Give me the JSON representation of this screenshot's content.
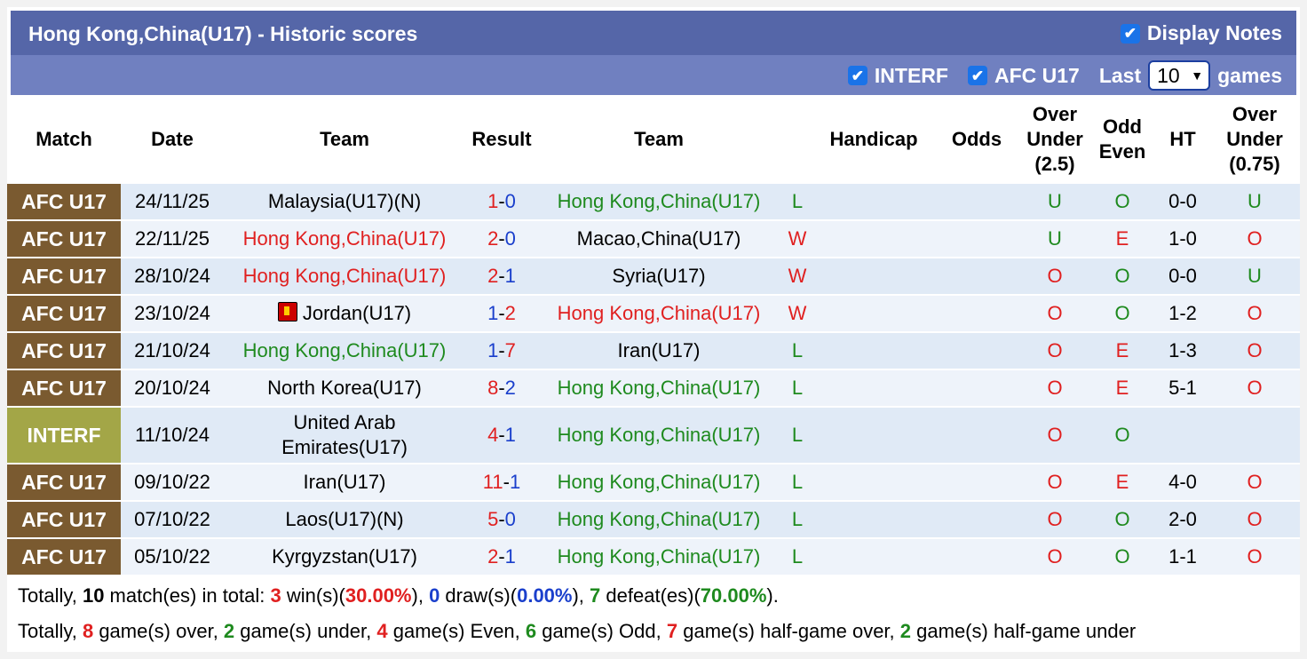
{
  "header": {
    "title": "Hong Kong,China(U17) - Historic scores",
    "display_notes_label": "Display Notes",
    "display_notes_checked": true
  },
  "filters": {
    "interf_label": "INTERF",
    "afc_label": "AFC U17",
    "last_label": "Last",
    "last_value": "10",
    "games_label": "games"
  },
  "columns": {
    "match": "Match",
    "date": "Date",
    "team_home": "Team",
    "result": "Result",
    "team_away": "Team",
    "handicap": "Handicap",
    "odds": "Odds",
    "ou_line1": "Over",
    "ou_line2": "Under",
    "ou_line3": "(2.5)",
    "oe_line1": "Odd",
    "oe_line2": "Even",
    "ht": "HT",
    "ouh_line1": "Over",
    "ouh_line2": "Under",
    "ouh_line3": "(0.75)"
  },
  "colors": {
    "afc": "#7a5a30",
    "interf": "#a3a647",
    "red": "#e02020",
    "green": "#1e8a1e",
    "blue": "#1a3fcc"
  },
  "rows": [
    {
      "league": "AFC U17",
      "league_type": "afc",
      "date": "24/11/25",
      "home": "Malaysia(U17)(N)",
      "home_color": "black",
      "home_flag": false,
      "score_home": "1",
      "score_home_color": "red",
      "score_away": "0",
      "score_away_color": "blue",
      "away": "Hong Kong,China(U17)",
      "away_color": "green",
      "wl": "L",
      "wl_color": "green",
      "handicap": "",
      "odds": "",
      "ou": "U",
      "ou_color": "green",
      "oe": "O",
      "oe_color": "green",
      "ht": "0-0",
      "ouh": "U",
      "ouh_color": "green"
    },
    {
      "league": "AFC U17",
      "league_type": "afc",
      "date": "22/11/25",
      "home": "Hong Kong,China(U17)",
      "home_color": "red",
      "home_flag": false,
      "score_home": "2",
      "score_home_color": "red",
      "score_away": "0",
      "score_away_color": "blue",
      "away": "Macao,China(U17)",
      "away_color": "black",
      "wl": "W",
      "wl_color": "red",
      "handicap": "",
      "odds": "",
      "ou": "U",
      "ou_color": "green",
      "oe": "E",
      "oe_color": "red",
      "ht": "1-0",
      "ouh": "O",
      "ouh_color": "red"
    },
    {
      "league": "AFC U17",
      "league_type": "afc",
      "date": "28/10/24",
      "home": "Hong Kong,China(U17)",
      "home_color": "red",
      "home_flag": false,
      "score_home": "2",
      "score_home_color": "red",
      "score_away": "1",
      "score_away_color": "blue",
      "away": "Syria(U17)",
      "away_color": "black",
      "wl": "W",
      "wl_color": "red",
      "handicap": "",
      "odds": "",
      "ou": "O",
      "ou_color": "red",
      "oe": "O",
      "oe_color": "green",
      "ht": "0-0",
      "ouh": "U",
      "ouh_color": "green"
    },
    {
      "league": "AFC U17",
      "league_type": "afc",
      "date": "23/10/24",
      "home": "Jordan(U17)",
      "home_color": "black",
      "home_flag": true,
      "score_home": "1",
      "score_home_color": "blue",
      "score_away": "2",
      "score_away_color": "red",
      "away": "Hong Kong,China(U17)",
      "away_color": "red",
      "wl": "W",
      "wl_color": "red",
      "handicap": "",
      "odds": "",
      "ou": "O",
      "ou_color": "red",
      "oe": "O",
      "oe_color": "green",
      "ht": "1-2",
      "ouh": "O",
      "ouh_color": "red"
    },
    {
      "league": "AFC U17",
      "league_type": "afc",
      "date": "21/10/24",
      "home": "Hong Kong,China(U17)",
      "home_color": "green",
      "home_flag": false,
      "score_home": "1",
      "score_home_color": "blue",
      "score_away": "7",
      "score_away_color": "red",
      "away": "Iran(U17)",
      "away_color": "black",
      "wl": "L",
      "wl_color": "green",
      "handicap": "",
      "odds": "",
      "ou": "O",
      "ou_color": "red",
      "oe": "E",
      "oe_color": "red",
      "ht": "1-3",
      "ouh": "O",
      "ouh_color": "red"
    },
    {
      "league": "AFC U17",
      "league_type": "afc",
      "date": "20/10/24",
      "home": "North Korea(U17)",
      "home_color": "black",
      "home_flag": false,
      "score_home": "8",
      "score_home_color": "red",
      "score_away": "2",
      "score_away_color": "blue",
      "away": "Hong Kong,China(U17)",
      "away_color": "green",
      "wl": "L",
      "wl_color": "green",
      "handicap": "",
      "odds": "",
      "ou": "O",
      "ou_color": "red",
      "oe": "E",
      "oe_color": "red",
      "ht": "5-1",
      "ouh": "O",
      "ouh_color": "red"
    },
    {
      "league": "INTERF",
      "league_type": "interf",
      "date": "11/10/24",
      "home_line1": "United Arab",
      "home_line2": "Emirates(U17)",
      "home_color": "black",
      "home_flag": false,
      "score_home": "4",
      "score_home_color": "red",
      "score_away": "1",
      "score_away_color": "blue",
      "away": "Hong Kong,China(U17)",
      "away_color": "green",
      "wl": "L",
      "wl_color": "green",
      "handicap": "",
      "odds": "",
      "ou": "O",
      "ou_color": "red",
      "oe": "O",
      "oe_color": "green",
      "ht": "",
      "ouh": "",
      "ouh_color": "red"
    },
    {
      "league": "AFC U17",
      "league_type": "afc",
      "date": "09/10/22",
      "home": "Iran(U17)",
      "home_color": "black",
      "home_flag": false,
      "score_home": "11",
      "score_home_color": "red",
      "score_away": "1",
      "score_away_color": "blue",
      "away": "Hong Kong,China(U17)",
      "away_color": "green",
      "wl": "L",
      "wl_color": "green",
      "handicap": "",
      "odds": "",
      "ou": "O",
      "ou_color": "red",
      "oe": "E",
      "oe_color": "red",
      "ht": "4-0",
      "ouh": "O",
      "ouh_color": "red"
    },
    {
      "league": "AFC U17",
      "league_type": "afc",
      "date": "07/10/22",
      "home": "Laos(U17)(N)",
      "home_color": "black",
      "home_flag": false,
      "score_home": "5",
      "score_home_color": "red",
      "score_away": "0",
      "score_away_color": "blue",
      "away": "Hong Kong,China(U17)",
      "away_color": "green",
      "wl": "L",
      "wl_color": "green",
      "handicap": "",
      "odds": "",
      "ou": "O",
      "ou_color": "red",
      "oe": "O",
      "oe_color": "green",
      "ht": "2-0",
      "ouh": "O",
      "ouh_color": "red"
    },
    {
      "league": "AFC U17",
      "league_type": "afc",
      "date": "05/10/22",
      "home": "Kyrgyzstan(U17)",
      "home_color": "black",
      "home_flag": false,
      "score_home": "2",
      "score_home_color": "red",
      "score_away": "1",
      "score_away_color": "blue",
      "away": "Hong Kong,China(U17)",
      "away_color": "green",
      "wl": "L",
      "wl_color": "green",
      "handicap": "",
      "odds": "",
      "ou": "O",
      "ou_color": "red",
      "oe": "O",
      "oe_color": "green",
      "ht": "1-1",
      "ouh": "O",
      "ouh_color": "red"
    }
  ],
  "summary": {
    "line1": {
      "p1": "Totally, ",
      "total": "10",
      "p2": " match(es) in total: ",
      "wins": "3",
      "p3": " win(s)(",
      "win_pct": "30.00%",
      "p4": "), ",
      "draws": "0",
      "p5": " draw(s)(",
      "draw_pct": "0.00%",
      "p6": "), ",
      "defeats": "7",
      "p7": " defeat(es)(",
      "defeat_pct": "70.00%",
      "p8": ")."
    },
    "line2": {
      "p1": "Totally, ",
      "over": "8",
      "p2": " game(s) over, ",
      "under": "2",
      "p3": " game(s) under, ",
      "even": "4",
      "p4": " game(s) Even, ",
      "odd": "6",
      "p5": " game(s) Odd, ",
      "hg_over": "7",
      "p6": " game(s) half-game over, ",
      "hg_under": "2",
      "p7": " game(s) half-game under"
    }
  }
}
